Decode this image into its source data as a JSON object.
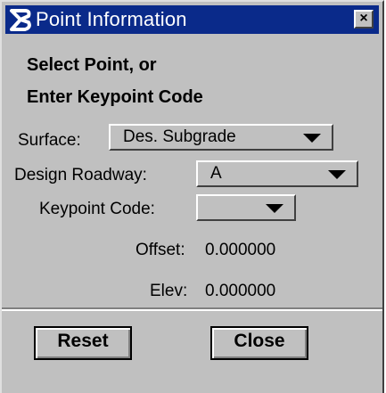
{
  "window": {
    "title": "Point Information",
    "close_glyph": "×",
    "icon": "bentley-b-icon"
  },
  "heading": {
    "line1": "Select Point, or",
    "line2": "Enter Keypoint Code"
  },
  "fields": {
    "surface": {
      "label": "Surface:",
      "value": "Des. Subgrade"
    },
    "design_roadway": {
      "label": "Design Roadway:",
      "value": "A"
    },
    "keypoint_code": {
      "label": "Keypoint Code:",
      "value": ""
    }
  },
  "readouts": {
    "offset": {
      "label": "Offset:",
      "value": "0.000000"
    },
    "elev": {
      "label": "Elev:",
      "value": "0.000000"
    }
  },
  "buttons": {
    "reset": "Reset",
    "close": "Close"
  },
  "colors": {
    "titlebar": "#0a2a8a",
    "face": "#c0c0c0"
  }
}
